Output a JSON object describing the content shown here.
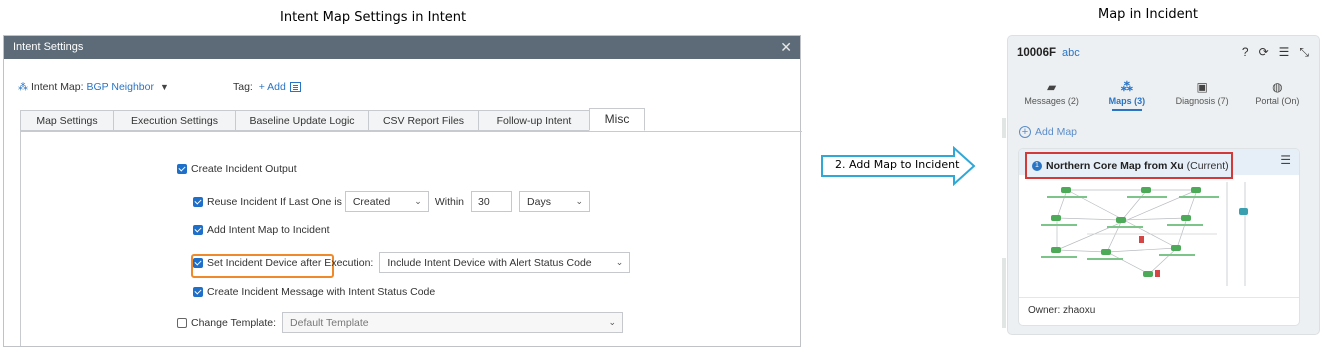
{
  "captions": {
    "left": "Intent Map Settings in Intent",
    "right": "Map in Incident"
  },
  "dialog": {
    "title": "Intent Settings",
    "close_glyph": "✕",
    "intent_map_label": "Intent Map:",
    "intent_map_value": "BGP Neighbor",
    "tag_label": "Tag:",
    "tag_add": "+ Add",
    "tabs": [
      {
        "label": "Map Settings"
      },
      {
        "label": "Execution Settings"
      },
      {
        "label": "Baseline Update Logic"
      },
      {
        "label": "CSV Report Files"
      },
      {
        "label": "Follow-up Intent"
      },
      {
        "label": "Misc"
      }
    ],
    "options": {
      "create_incident": "Create Incident Output",
      "reuse_incident": "Reuse Incident If Last One is",
      "reuse_select": "Created",
      "within": "Within",
      "within_value": "30",
      "within_unit": "Days",
      "add_intent_map": "Add Intent Map to Incident",
      "set_device": "Set Incident Device after Execution:",
      "set_device_select": "Include Intent Device with Alert Status Code",
      "create_message": "Create Incident Message with Intent Status Code",
      "change_template": "Change Template:",
      "template_select": "Default Template"
    }
  },
  "arrow_label": "2. Add Map to Incident",
  "incident": {
    "id": "10006F",
    "name": "abc",
    "tabs": [
      {
        "label": "Messages (2)",
        "icon": "messages-icon"
      },
      {
        "label": "Maps (3)",
        "icon": "maps-icon"
      },
      {
        "label": "Diagnosis (7)",
        "icon": "diagnosis-icon"
      },
      {
        "label": "Portal (On)",
        "icon": "portal-icon"
      }
    ],
    "add_map": "Add Map",
    "card": {
      "number": "1",
      "title": "Northern Core Map from Xu",
      "status": "(Current)",
      "owner": "Owner: zhaoxu"
    }
  },
  "colors": {
    "title_bar": "#5d6b78",
    "accent_blue": "#2a74c4",
    "highlight_orange": "#ef8a2c",
    "highlight_red": "#d23a3a",
    "arrow_cyan": "#2fa8d8"
  }
}
